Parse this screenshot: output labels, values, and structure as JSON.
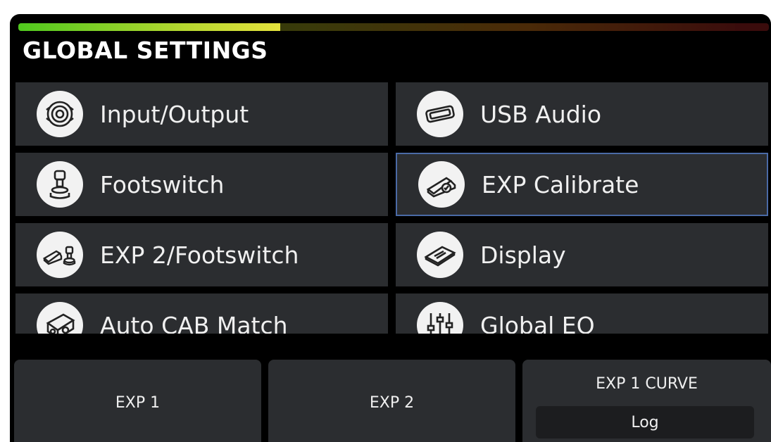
{
  "meter": {
    "level": 0.36
  },
  "header": {
    "title": "GLOBAL SETTINGS"
  },
  "menu": {
    "items": [
      {
        "label": "Input/Output",
        "icon": "jack-icon"
      },
      {
        "label": "USB Audio",
        "icon": "usb-port-icon"
      },
      {
        "label": "Footswitch",
        "icon": "footswitch-icon"
      },
      {
        "label": "EXP Calibrate",
        "icon": "expression-pedal-check-icon",
        "selected": true
      },
      {
        "label": "EXP 2/Footswitch",
        "icon": "pedal-footswitch-icon"
      },
      {
        "label": "Display",
        "icon": "display-icon"
      },
      {
        "label": "Auto CAB Match",
        "icon": "cabinet-icon"
      },
      {
        "label": "Global EQ",
        "icon": "eq-sliders-icon"
      }
    ]
  },
  "softkeys": {
    "exp1": "EXP 1",
    "exp2": "EXP 2",
    "curve_title": "EXP 1 CURVE",
    "curve_value": "Log"
  }
}
